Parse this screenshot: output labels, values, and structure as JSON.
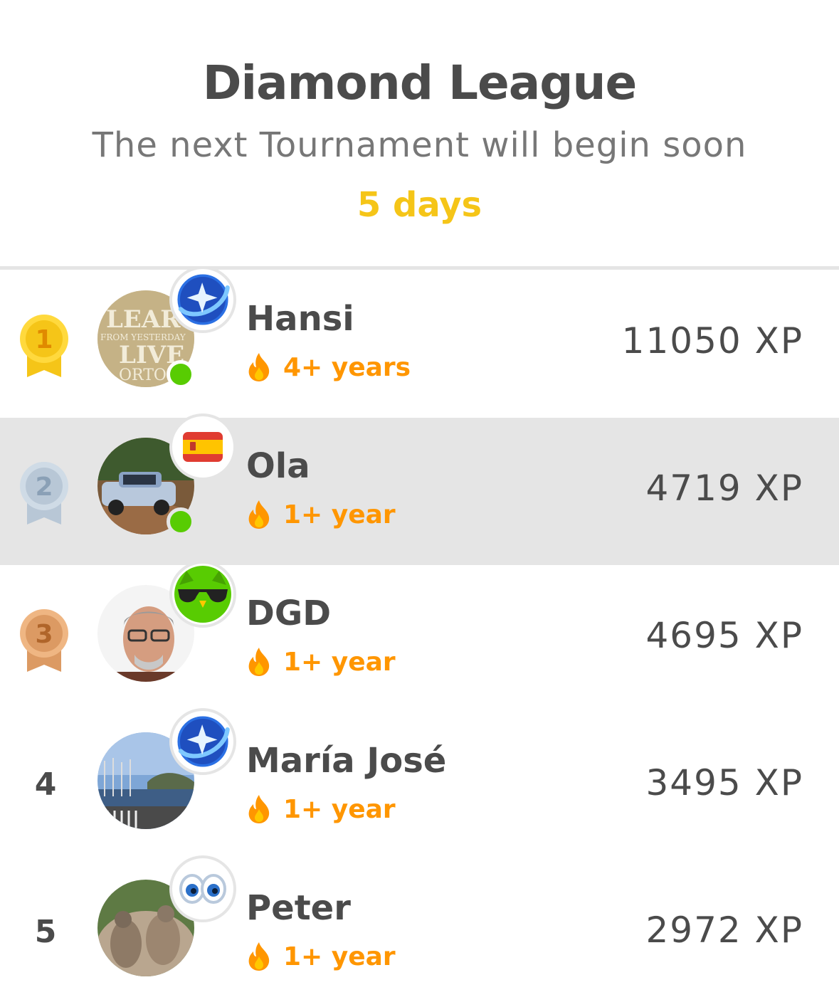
{
  "header": {
    "title": "Diamond League",
    "subtitle": "The next Tournament will begin soon",
    "countdown": "5 days"
  },
  "colors": {
    "countdown": "#f5c518",
    "streak": "#ff9600",
    "online": "#58cc02",
    "highlight_row": "#e5e5e5",
    "gold": "#f5c518",
    "silver": "#b8c7d6",
    "bronze": "#dc9a63"
  },
  "leaderboard": [
    {
      "rank": "1",
      "medal": "gold-medal",
      "name": "Hansi",
      "streak": "4+ years",
      "xp": "11050 XP",
      "online": true,
      "badge": "league-planet-icon",
      "highlighted": false,
      "avatar_text": [
        "LEAR",
        "FROM YESTERDAY",
        "LIVE",
        "ORTO"
      ]
    },
    {
      "rank": "2",
      "medal": "silver-medal",
      "name": "Ola",
      "streak": "1+ year",
      "xp": "4719 XP",
      "online": true,
      "badge": "spain-flag-icon",
      "highlighted": true
    },
    {
      "rank": "3",
      "medal": "bronze-medal",
      "name": "DGD",
      "streak": "1+ year",
      "xp": "4695 XP",
      "online": false,
      "badge": "owl-sunglasses-icon",
      "highlighted": false
    },
    {
      "rank": "4",
      "name": "María José",
      "streak": "1+ year",
      "xp": "3495 XP",
      "online": false,
      "badge": "league-planet-icon",
      "highlighted": false
    },
    {
      "rank": "5",
      "name": "Peter",
      "streak": "1+ year",
      "xp": "2972 XP",
      "online": false,
      "badge": "eyes-icon",
      "highlighted": false
    }
  ]
}
